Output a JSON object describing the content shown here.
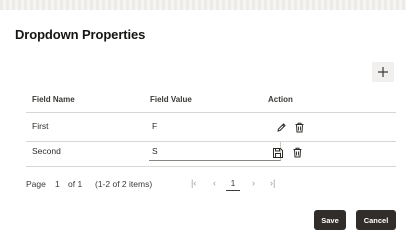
{
  "dialog": {
    "title": "Dropdown Properties"
  },
  "toolbar": {
    "add_icon": "plus-icon"
  },
  "table": {
    "columns": [
      "Field Name",
      "Field Value",
      "Action"
    ],
    "rows": [
      {
        "field_name": "First",
        "field_value": "F",
        "actions": [
          "edit-icon",
          "delete-icon"
        ]
      },
      {
        "field_name": "Second",
        "field_value": "S",
        "actions": [
          "save-icon",
          "delete-icon"
        ]
      }
    ]
  },
  "pagination": {
    "page_label": "Page",
    "current_page": "1",
    "of_label": "of 1",
    "range_label": "(1-2 of 2 items)",
    "page_input": "1"
  },
  "footer": {
    "save_label": "Save",
    "cancel_label": "Cancel"
  },
  "colors": {
    "primary_button": "#312d2a",
    "text": "#161513",
    "divider": "#d9d7d3"
  }
}
